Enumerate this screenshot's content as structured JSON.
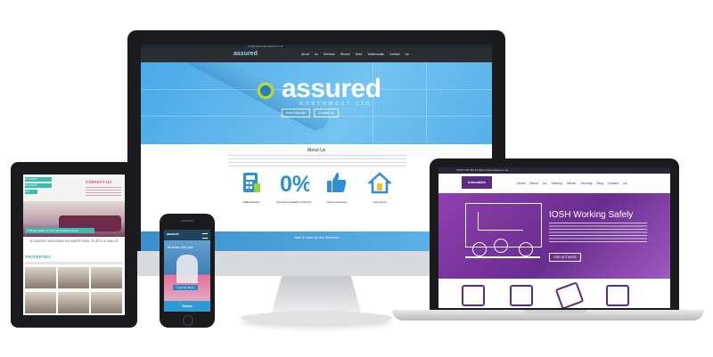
{
  "desktop": {
    "contact_bar": "info@assurednorthwest.co.uk",
    "nav_logo": "assured",
    "nav_links": "About Us  Services  Recent Work  Testimonials  Contact Us",
    "logo_text": "assured",
    "logo_sub": "NORTHWEST LTD",
    "buttons": [
      "Free Estimate",
      "Contact Us"
    ],
    "about_title": "About Us",
    "features": [
      {
        "icon": "calculator-icon",
        "label": "FREE Estimates",
        "color": "#2f8fd6"
      },
      {
        "icon": "percent-icon",
        "label": "0% Finance Available On All Work",
        "color": "#2f8fd6"
      },
      {
        "icon": "thumbs-up-icon",
        "label": "Quality Guaranteed",
        "color": "#2f8fd6"
      },
      {
        "icon": "house-icon",
        "label": "Fully Insured",
        "color": "#2f8fd6"
      }
    ],
    "footer_text": "Take A Look At Our Services"
  },
  "tablet": {
    "brand_lines": [
      "STUDENT",
      "HOUSING",
      "NW"
    ],
    "contact_heading": "CONTACT US",
    "banner_text": "A Simple Stage To Your Next Student Home",
    "caption": "STUDENT HOUSING IN HARTFORD, FLATS & HALLS",
    "properties_heading": "PROPERTIES",
    "accent": "#3bbcae"
  },
  "phone": {
    "logo": "assured",
    "title": "Be inside of the plan",
    "button": "Find Out More",
    "video_label": "Videos"
  },
  "laptop": {
    "top_contact": "07570 356 000   info@innovativesafety.co.uk",
    "logo": "innovative",
    "nav_links": "Home  About Us  Training  Advice  Security  Blog  Contact Us",
    "hero_title": "IOSH Working Safely",
    "hero_button": "FIND OUT MORE",
    "brand_color": "#5b2e7d"
  }
}
